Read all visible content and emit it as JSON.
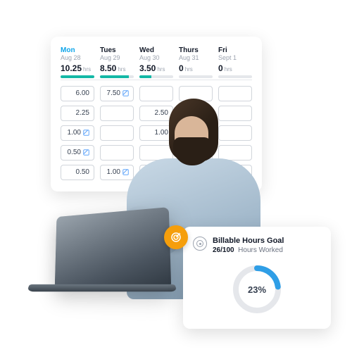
{
  "timesheet": {
    "unit": "hrs",
    "days": [
      {
        "name": "Mon",
        "date": "Aug 28",
        "total": "10.25",
        "fill": 100,
        "current": true
      },
      {
        "name": "Tues",
        "date": "Aug 29",
        "total": "8.50",
        "fill": 85,
        "current": false
      },
      {
        "name": "Wed",
        "date": "Aug 30",
        "total": "3.50",
        "fill": 35,
        "current": false
      },
      {
        "name": "Thurs",
        "date": "Aug 31",
        "total": "0",
        "fill": 0,
        "current": false
      },
      {
        "name": "Fri",
        "date": "Sept 1",
        "total": "0",
        "fill": 0,
        "current": false
      }
    ],
    "rows": [
      [
        {
          "v": "6.00",
          "note": false
        },
        {
          "v": "7.50",
          "note": true
        },
        {
          "v": "",
          "note": false
        },
        {
          "v": "",
          "note": false
        },
        {
          "v": "",
          "note": false
        }
      ],
      [
        {
          "v": "2.25",
          "note": false
        },
        {
          "v": "",
          "note": false
        },
        {
          "v": "2.50",
          "note": false
        },
        {
          "v": "",
          "note": false
        },
        {
          "v": "",
          "note": false
        }
      ],
      [
        {
          "v": "1.00",
          "note": true
        },
        {
          "v": "",
          "note": false
        },
        {
          "v": "1.00",
          "note": false
        },
        {
          "v": "",
          "note": false
        },
        {
          "v": "",
          "note": false
        }
      ],
      [
        {
          "v": "0.50",
          "note": true
        },
        {
          "v": "",
          "note": false
        },
        {
          "v": "",
          "note": false
        },
        {
          "v": "",
          "note": false
        },
        {
          "v": "",
          "note": false
        }
      ],
      [
        {
          "v": "0.50",
          "note": false
        },
        {
          "v": "1.00",
          "note": true
        },
        {
          "v": "",
          "note": false
        },
        {
          "v": "",
          "note": false
        },
        {
          "v": "",
          "note": false
        }
      ]
    ]
  },
  "goal": {
    "title": "Billable Hours Goal",
    "progress_numer": "26",
    "progress_denom": "100",
    "progress_sep": "/",
    "subtitle": "Hours Worked",
    "percent_label": "23%",
    "percent_value": 23
  },
  "colors": {
    "accent": "#14b8a6",
    "ring": "#2f9ee6",
    "badge": "#f59e0b"
  }
}
